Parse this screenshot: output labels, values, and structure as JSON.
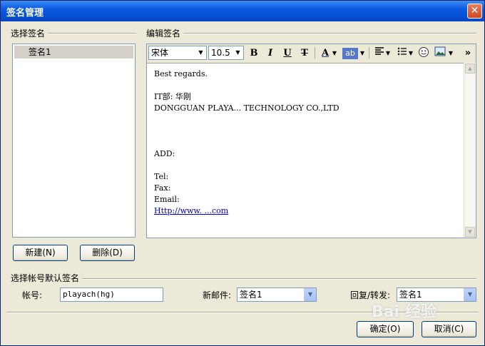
{
  "window": {
    "title": "签名管理",
    "close_glyph": "✕"
  },
  "left": {
    "group_label": "选择签名",
    "signatures": [
      "签名1"
    ],
    "new_button": "新建(N)",
    "delete_button": "删除(D)"
  },
  "editor": {
    "group_label": "编辑签名",
    "font_name": "宋体",
    "font_size": "10.5",
    "toolbar": {
      "bold": "B",
      "italic": "I",
      "underline": "U",
      "strike": "T",
      "font_color": "A",
      "highlight": "ab",
      "more": "»"
    },
    "lines": [
      "Best regards.",
      "",
      "IT部: 华刚",
      "DONGGUAN PLAYA... TECHNOLOGY CO.,LTD",
      "",
      "",
      "",
      "ADD:",
      "",
      "Tel:",
      "Fax:",
      "Email:",
      "Http://www. ...com"
    ]
  },
  "accounts": {
    "group_label": "选择帐号默认签名",
    "account_label": "帐号:",
    "account_value": "playach(hg)",
    "new_mail_label": "新邮件:",
    "new_mail_value": "签名1",
    "reply_label": "回复/转发:",
    "reply_value": "签名1"
  },
  "footer": {
    "ok_button": "确定(O)",
    "cancel_button": "取消(C)"
  },
  "watermark": "Bai 经验"
}
